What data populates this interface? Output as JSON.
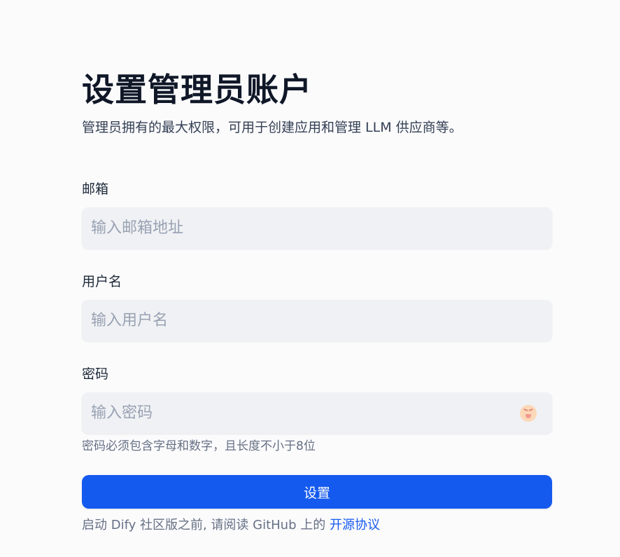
{
  "page": {
    "title": "设置管理员账户",
    "subtitle": "管理员拥有的最大权限，可用于创建应用和管理 LLM 供应商等。"
  },
  "form": {
    "email": {
      "label": "邮箱",
      "placeholder": "输入邮箱地址",
      "value": ""
    },
    "username": {
      "label": "用户名",
      "placeholder": "输入用户名",
      "value": ""
    },
    "password": {
      "label": "密码",
      "placeholder": "输入密码",
      "value": "",
      "toggle_icon": "squinting-tongue-face-icon",
      "hint": "密码必须包含字母和数字，且长度不小于8位"
    },
    "submit_label": "设置"
  },
  "footer": {
    "prefix": "启动 Dify 社区版之前, 请阅读 GitHub 上的 ",
    "link_label": "开源协议"
  },
  "colors": {
    "primary": "#155aef",
    "input_bg": "#f0f1f4",
    "page_bg": "#fbfbfc"
  }
}
